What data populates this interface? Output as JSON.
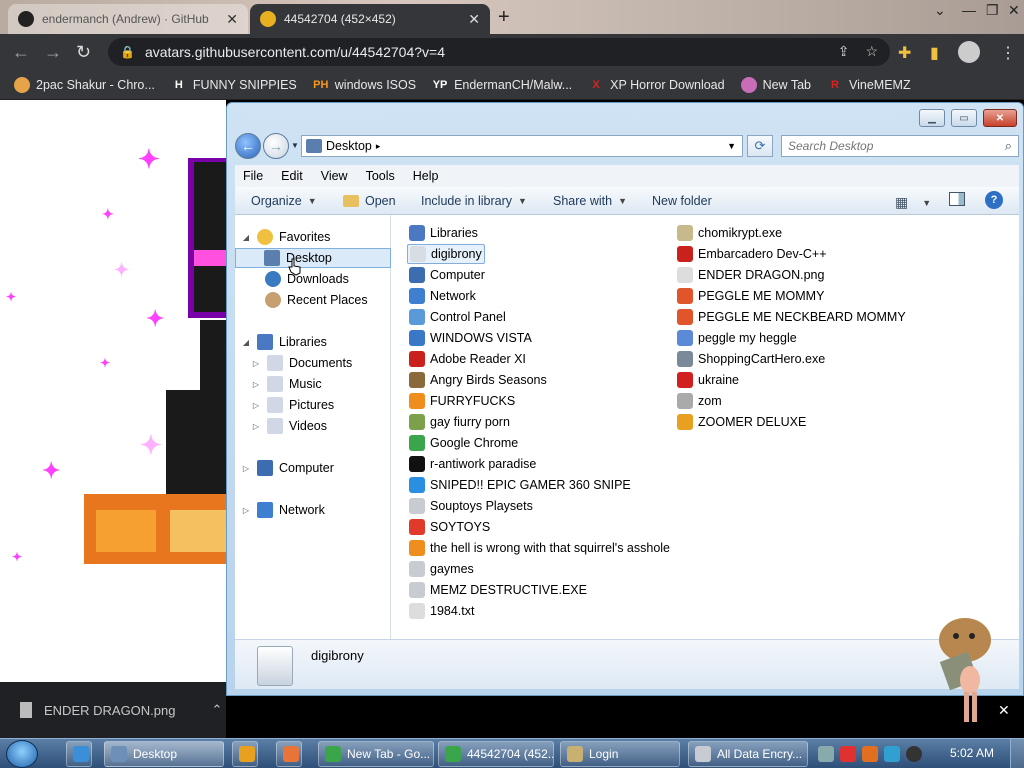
{
  "browser": {
    "tabs": [
      {
        "title": "endermanch (Andrew) · GitHub",
        "favicon": "github-icon",
        "active": false
      },
      {
        "title": "44542704 (452×452)",
        "favicon": "image-icon",
        "active": true
      }
    ],
    "url": "avatars.githubusercontent.com/u/44542704?v=4",
    "bookmarks": [
      {
        "label": "2pac Shakur - Chro...",
        "icon": "bookmark-2pac-icon",
        "color": "#e6a34a"
      },
      {
        "label": "FUNNY SNIPPIES",
        "icon": "h-icon",
        "glyph": "H",
        "color": "#ffffff"
      },
      {
        "label": "windows ISOS",
        "icon": "ph-icon",
        "glyph": "PH",
        "color": "#f7971d"
      },
      {
        "label": "EndermanCH/Malw...",
        "icon": "yp-icon",
        "glyph": "YP",
        "color": "#ffffff"
      },
      {
        "label": "XP Horror Download",
        "icon": "x-icon",
        "glyph": "X",
        "color": "#e0201b"
      },
      {
        "label": "New Tab",
        "icon": "globe-icon",
        "color": "#c96db8"
      },
      {
        "label": "VineMEMZ",
        "icon": "r-icon",
        "glyph": "R",
        "color": "#e0201b"
      }
    ]
  },
  "download": {
    "filename": "ENDER DRAGON.png"
  },
  "explorer": {
    "address": "Desktop",
    "search_placeholder": "Search Desktop",
    "menu": [
      "File",
      "Edit",
      "View",
      "Tools",
      "Help"
    ],
    "commands": [
      "Organize",
      "Open",
      "Include in library",
      "Share with",
      "New folder"
    ],
    "nav": {
      "favorites": "Favorites",
      "favorites_items": [
        "Desktop",
        "Downloads",
        "Recent Places"
      ],
      "libraries": "Libraries",
      "libraries_items": [
        "Documents",
        "Music",
        "Pictures",
        "Videos"
      ],
      "computer": "Computer",
      "network": "Network"
    },
    "files_col1": [
      {
        "name": "Libraries",
        "color": "#4a78c2"
      },
      {
        "name": "digibrony",
        "color": "#d8dde4"
      },
      {
        "name": "Computer",
        "color": "#3c6db0"
      },
      {
        "name": "Network",
        "color": "#3f7fcf"
      },
      {
        "name": "Control Panel",
        "color": "#5a9ad8"
      },
      {
        "name": "WINDOWS VISTA",
        "color": "#3a77c6"
      },
      {
        "name": "Adobe Reader XI",
        "color": "#c9221d"
      },
      {
        "name": "Angry Birds Seasons",
        "color": "#8a6a3a"
      },
      {
        "name": "FURRYFUCKS",
        "color": "#f08d1f"
      },
      {
        "name": "gay fiurry porn",
        "color": "#7da04a"
      },
      {
        "name": "Google Chrome",
        "color": "#3aa54a"
      },
      {
        "name": "r-antiwork paradise",
        "color": "#111111"
      },
      {
        "name": "SNIPED!! EPIC GAMER 360 SNIPE",
        "color": "#2a8fe0"
      },
      {
        "name": "Souptoys Playsets",
        "color": "#c8ccd2"
      },
      {
        "name": "SOYTOYS",
        "color": "#e03a2a"
      },
      {
        "name": "the hell is wrong with that squirrel's asshole",
        "color": "#f08d1f"
      },
      {
        "name": "gaymes",
        "color": "#c8ccd2"
      },
      {
        "name": "MEMZ DESTRUCTIVE.EXE",
        "color": "#c8ccd2"
      },
      {
        "name": "1984.txt",
        "color": "#dddddd"
      }
    ],
    "files_col2": [
      {
        "name": "chomikrypt.exe",
        "color": "#c8b98a"
      },
      {
        "name": "Embarcadero Dev-C++",
        "color": "#c9221d"
      },
      {
        "name": "ENDER DRAGON.png",
        "color": "#dddddd"
      },
      {
        "name": "PEGGLE ME MOMMY",
        "color": "#e0552a"
      },
      {
        "name": "PEGGLE ME NECKBEARD MOMMY",
        "color": "#e0552a"
      },
      {
        "name": "peggle my heggle",
        "color": "#5a8ad8"
      },
      {
        "name": "ShoppingCartHero.exe",
        "color": "#7a8a9a"
      },
      {
        "name": "ukraine",
        "color": "#d02020"
      },
      {
        "name": "zom",
        "color": "#aaaaaa"
      },
      {
        "name": "ZOOMER DELUXE",
        "color": "#e8a020"
      }
    ],
    "selected": "digibrony",
    "details_name": "digibrony"
  },
  "taskbar": {
    "buttons": [
      {
        "label": "",
        "icon": "ie-icon",
        "color": "#3a8fd8"
      },
      {
        "label": "Desktop",
        "icon": "explorer-icon",
        "color": "#6d8fb8"
      },
      {
        "label": "",
        "icon": "media-icon",
        "color": "#e8a020"
      },
      {
        "label": "",
        "icon": "app-icon",
        "color": "#e8743a"
      },
      {
        "label": "New Tab - Go...",
        "icon": "chrome-icon",
        "color": "#3aa54a"
      },
      {
        "label": "44542704 (452...",
        "icon": "chrome-icon",
        "color": "#3aa54a"
      },
      {
        "label": "Login",
        "icon": "login-icon",
        "color": "#c8b070"
      },
      {
        "label": "All Data Encry...",
        "icon": "encrypt-icon",
        "color": "#c8ccd2"
      }
    ],
    "clock": "5:02 AM"
  }
}
